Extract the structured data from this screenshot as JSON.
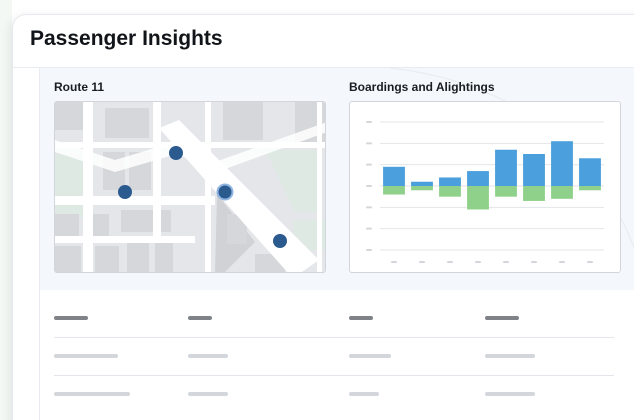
{
  "header": {
    "title": "Passenger Insights"
  },
  "route_section": {
    "title": "Route 11",
    "stops": [
      {
        "name": "stop-1",
        "selected": false
      },
      {
        "name": "stop-2",
        "selected": false
      },
      {
        "name": "stop-3",
        "selected": true
      },
      {
        "name": "stop-4",
        "selected": false
      }
    ]
  },
  "chart_section": {
    "title": "Boardings and Alightings"
  },
  "chart_data": {
    "type": "bar",
    "title": "Boardings and Alightings",
    "categories": [
      "",
      "",
      "",
      "",
      "",
      "",
      "",
      ""
    ],
    "series": [
      {
        "values": [
          9,
          2,
          4,
          7,
          17,
          15,
          21,
          13
        ]
      },
      {
        "values": [
          -4,
          -2,
          -5,
          -11,
          -5,
          -7,
          -6,
          -2
        ]
      }
    ],
    "ylim": [
      -30,
      30
    ],
    "grid": true,
    "colors": [
      "#4a9fdc",
      "#8fd08a"
    ]
  },
  "colors": {
    "stop_marker": "#2b5a8f",
    "road": "#ffffff",
    "block": "#d5d7da",
    "park": "#dfe9e3",
    "panel_bg": "#f4f7fb"
  }
}
